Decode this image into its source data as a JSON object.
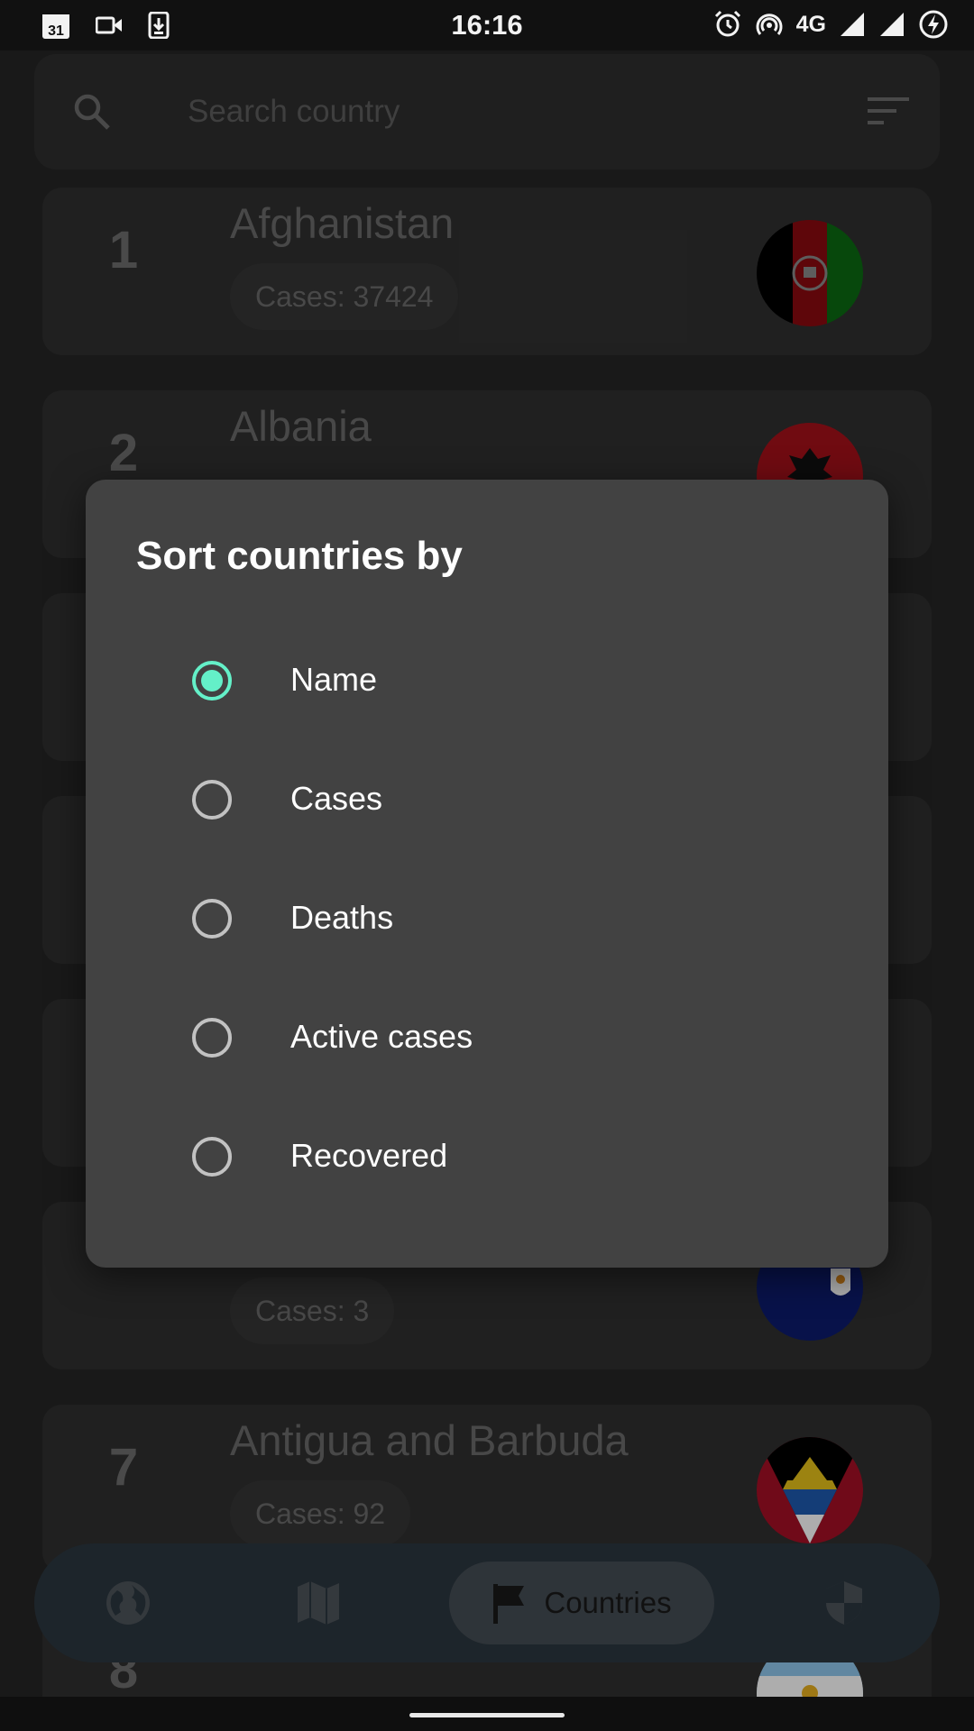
{
  "status_bar": {
    "time": "16:16",
    "network": "4G",
    "left_icons": [
      "calendar-icon",
      "video-camera-icon",
      "download-icon"
    ],
    "right_icons": [
      "alarm-icon",
      "hotspot-icon",
      "signal-icon",
      "signal-icon",
      "battery-charging-icon"
    ],
    "calendar_day": "31"
  },
  "search": {
    "placeholder": "Search country",
    "icon": "search-icon",
    "sort_icon": "sort-icon"
  },
  "countries": [
    {
      "rank": "1",
      "name": "Afghanistan",
      "cases": "Cases: 37424",
      "flag": "afghanistan-flag"
    },
    {
      "rank": "2",
      "name": "Albania",
      "cases": "",
      "flag": "albania-flag"
    },
    {
      "rank": "",
      "name": "",
      "cases": "",
      "flag": ""
    },
    {
      "rank": "",
      "name": "",
      "cases": "",
      "flag": ""
    },
    {
      "rank": "",
      "name": "",
      "cases": "",
      "flag": ""
    },
    {
      "rank": "",
      "name": "",
      "cases": "Cases: 3",
      "flag": "anguilla-flag"
    },
    {
      "rank": "7",
      "name": "Antigua and Barbuda",
      "cases": "Cases: 92",
      "flag": "antigua-flag"
    },
    {
      "rank": "8",
      "name": "",
      "cases": "",
      "flag": "argentina-flag"
    }
  ],
  "bottom_nav": {
    "items": [
      {
        "icon": "globe-icon",
        "label": ""
      },
      {
        "icon": "map-icon",
        "label": ""
      },
      {
        "icon": "flag-icon",
        "label": "Countries",
        "active": true
      },
      {
        "icon": "shield-icon",
        "label": ""
      }
    ]
  },
  "dialog": {
    "title": "Sort countries by",
    "options": [
      {
        "label": "Name",
        "selected": true
      },
      {
        "label": "Cases",
        "selected": false
      },
      {
        "label": "Deaths",
        "selected": false
      },
      {
        "label": "Active cases",
        "selected": false
      },
      {
        "label": "Recovered",
        "selected": false
      }
    ],
    "accent_color": "#64f0c8"
  }
}
